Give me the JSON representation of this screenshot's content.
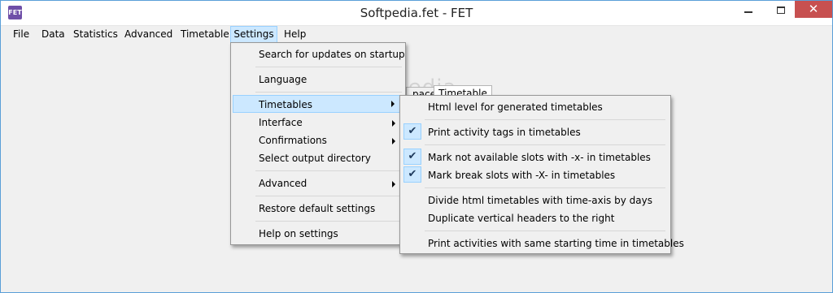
{
  "window": {
    "title": "Softpedia.fet - FET",
    "app_icon_text": "FET",
    "close_glyph": "✕"
  },
  "menubar": {
    "items": [
      "File",
      "Data",
      "Statistics",
      "Advanced",
      "Timetable",
      "Settings",
      "Help"
    ],
    "active": "Settings"
  },
  "background_tabs": {
    "partial_label": "pace",
    "timetable_label": "Timetable",
    "watermark": "Softpedia"
  },
  "settings_menu": {
    "items": [
      {
        "label": "Search for updates on startup"
      },
      {
        "label": "Language"
      },
      {
        "label": "Timetables",
        "submenu": true,
        "highlighted": true
      },
      {
        "label": "Interface",
        "submenu": true
      },
      {
        "label": "Confirmations",
        "submenu": true
      },
      {
        "label": "Select output directory"
      },
      {
        "label": "Advanced",
        "submenu": true
      },
      {
        "label": "Restore default settings"
      },
      {
        "label": "Help on settings"
      }
    ]
  },
  "timetables_submenu": {
    "items": [
      {
        "label": "Html level for generated timetables",
        "checked": false
      },
      {
        "label": "Print activity tags in timetables",
        "checked": true
      },
      {
        "label": "Mark not available slots with -x- in timetables",
        "checked": true
      },
      {
        "label": "Mark break slots with -X- in timetables",
        "checked": true
      },
      {
        "label": "Divide html timetables with time-axis by days",
        "checked": false
      },
      {
        "label": "Duplicate vertical headers to the right",
        "checked": false
      },
      {
        "label": "Print activities with same starting time in timetables",
        "checked": false
      }
    ],
    "check_glyph": "✔"
  },
  "colors": {
    "highlight": "#cce8ff",
    "highlight_border": "#99d1ff",
    "close_button": "#c75050",
    "window_border": "#5a9fd8"
  }
}
